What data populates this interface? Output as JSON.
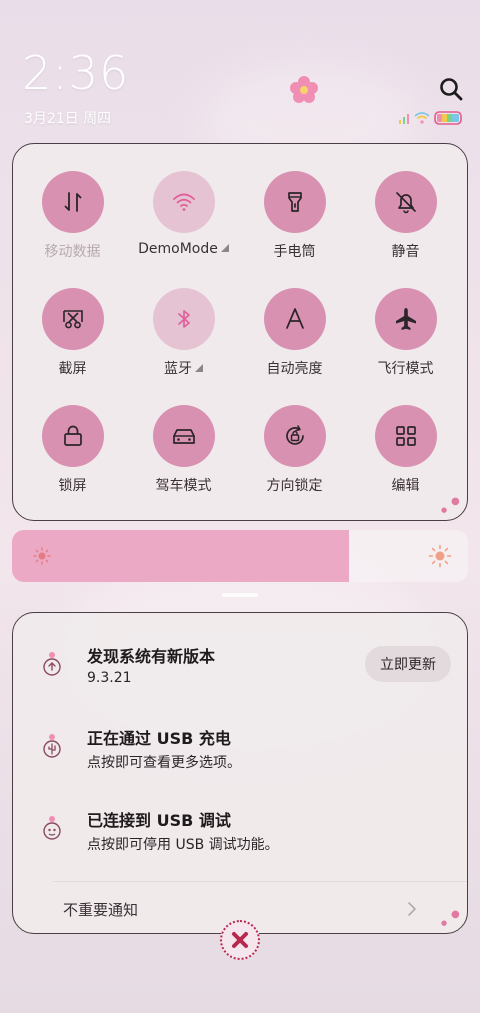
{
  "status_bar": {
    "time": "2:36",
    "date": "3月21日 周四"
  },
  "quick_settings": {
    "tiles": [
      {
        "id": "mobile-data",
        "label": "移动数据",
        "icon": "data-transfer-icon",
        "active": false
      },
      {
        "id": "wifi",
        "label": "DemoMode",
        "icon": "wifi-icon",
        "active": false,
        "has_menu": true
      },
      {
        "id": "flashlight",
        "label": "手电筒",
        "icon": "flashlight-icon",
        "active": true
      },
      {
        "id": "mute",
        "label": "静音",
        "icon": "bell-off-icon",
        "active": true
      },
      {
        "id": "screenshot",
        "label": "截屏",
        "icon": "scissors-icon",
        "active": true
      },
      {
        "id": "bluetooth",
        "label": "蓝牙",
        "icon": "bluetooth-icon",
        "active": false,
        "has_menu": true
      },
      {
        "id": "auto-brightness",
        "label": "自动亮度",
        "icon": "letter-a-icon",
        "active": true
      },
      {
        "id": "airplane",
        "label": "飞行模式",
        "icon": "airplane-icon",
        "active": true
      },
      {
        "id": "lock-screen",
        "label": "锁屏",
        "icon": "lock-icon",
        "active": true
      },
      {
        "id": "driving",
        "label": "驾车模式",
        "icon": "car-icon",
        "active": true
      },
      {
        "id": "rotation-lock",
        "label": "方向锁定",
        "icon": "rotation-lock-icon",
        "active": true
      },
      {
        "id": "edit",
        "label": "编辑",
        "icon": "grid-icon",
        "active": true
      }
    ]
  },
  "brightness": {
    "level": 0.74
  },
  "notifications": [
    {
      "title": "发现系统有新版本",
      "text": "9.3.21",
      "action": "立即更新",
      "icon": "update-icon"
    },
    {
      "title": "正在通过 USB 充电",
      "text": "点按即可查看更多选项。",
      "icon": "usb-charge-icon"
    },
    {
      "title": "已连接到 USB 调试",
      "text": "点按即可停用 USB 调试功能。",
      "icon": "usb-debug-icon"
    }
  ],
  "unimportant_label": "不重要通知",
  "colors": {
    "accent": "#d991b2",
    "accent_off": "#e6c3d3",
    "brightness_fill": "#eba9c6",
    "close": "#b7284f"
  }
}
